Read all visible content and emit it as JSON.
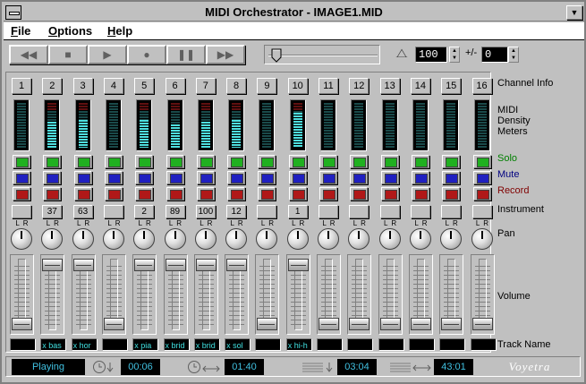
{
  "window": {
    "title": "MIDI Orchestrator - IMAGE1.MID"
  },
  "menu": {
    "items": [
      "File",
      "Options",
      "Help"
    ]
  },
  "transport": {
    "buttons": [
      {
        "name": "rewind-button",
        "icon": "rewind-icon",
        "glyph": "◀◀"
      },
      {
        "name": "stop-button",
        "icon": "stop-icon",
        "glyph": "■"
      },
      {
        "name": "play-button",
        "icon": "play-icon",
        "glyph": "▶"
      },
      {
        "name": "record-button",
        "icon": "record-icon",
        "glyph": "●"
      },
      {
        "name": "pause-button",
        "icon": "pause-icon",
        "glyph": "❚❚"
      },
      {
        "name": "fast-forward-button",
        "icon": "fast-forward-icon",
        "glyph": "▶▶"
      }
    ],
    "position_fraction": 0.03,
    "metronome_glyph": "⧍",
    "tempo": "100",
    "transpose_label": "+/-",
    "transpose": "0"
  },
  "channels": [
    {
      "number": "1",
      "instrument": "",
      "meter_level": 0.0,
      "meter_red": false,
      "volume": 0.0,
      "track": ""
    },
    {
      "number": "2",
      "instrument": "37",
      "meter_level": 0.55,
      "meter_red": true,
      "volume": 1.0,
      "track": "x bas"
    },
    {
      "number": "3",
      "instrument": "63",
      "meter_level": 0.6,
      "meter_red": true,
      "volume": 1.0,
      "track": "x hor"
    },
    {
      "number": "4",
      "instrument": "",
      "meter_level": 0.0,
      "meter_red": false,
      "volume": 0.0,
      "track": ""
    },
    {
      "number": "5",
      "instrument": "2",
      "meter_level": 0.6,
      "meter_red": true,
      "volume": 1.0,
      "track": "x pia"
    },
    {
      "number": "6",
      "instrument": "89",
      "meter_level": 0.5,
      "meter_red": true,
      "volume": 1.0,
      "track": "x brid"
    },
    {
      "number": "7",
      "instrument": "100",
      "meter_level": 0.55,
      "meter_red": true,
      "volume": 1.0,
      "track": "x brid"
    },
    {
      "number": "8",
      "instrument": "12",
      "meter_level": 0.6,
      "meter_red": true,
      "volume": 1.0,
      "track": "x sol"
    },
    {
      "number": "9",
      "instrument": "",
      "meter_level": 0.0,
      "meter_red": false,
      "volume": 0.0,
      "track": ""
    },
    {
      "number": "10",
      "instrument": "1",
      "meter_level": 0.75,
      "meter_red": true,
      "volume": 1.0,
      "track": "x hi-h"
    },
    {
      "number": "11",
      "instrument": "",
      "meter_level": 0.0,
      "meter_red": false,
      "volume": 0.0,
      "track": ""
    },
    {
      "number": "12",
      "instrument": "",
      "meter_level": 0.0,
      "meter_red": false,
      "volume": 0.0,
      "track": ""
    },
    {
      "number": "13",
      "instrument": "",
      "meter_level": 0.0,
      "meter_red": false,
      "volume": 0.0,
      "track": ""
    },
    {
      "number": "14",
      "instrument": "",
      "meter_level": 0.0,
      "meter_red": false,
      "volume": 0.0,
      "track": ""
    },
    {
      "number": "15",
      "instrument": "",
      "meter_level": 0.0,
      "meter_red": false,
      "volume": 0.0,
      "track": ""
    },
    {
      "number": "16",
      "instrument": "",
      "meter_level": 0.0,
      "meter_red": false,
      "volume": 0.0,
      "track": ""
    }
  ],
  "pan_label": "L R",
  "labels": {
    "channel_info": "Channel Info",
    "density_1": "MIDI",
    "density_2": "Density",
    "density_3": "Meters",
    "solo": "Solo",
    "mute": "Mute",
    "record": "Record",
    "instrument": "Instrument",
    "pan": "Pan",
    "volume": "Volume",
    "track_name": "Track Name"
  },
  "label_colors": {
    "solo": "#008000",
    "mute": "#000080",
    "record": "#800000"
  },
  "status": {
    "state": "Playing",
    "elapsed": "00:06",
    "total": "01:40",
    "current_measure": "03:04",
    "total_measures": "43:01",
    "brand": "Voyetra"
  }
}
